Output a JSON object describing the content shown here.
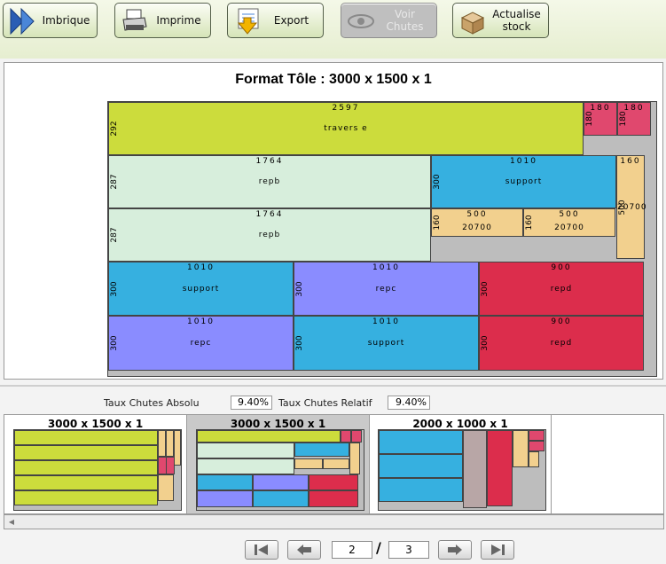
{
  "toolbar": {
    "imbrique": "Imbrique",
    "imprime": "Imprime",
    "export": "Export",
    "voir_chutes": "Voir\nChutes",
    "actualise_stock": "Actualise\nstock"
  },
  "main": {
    "title": "Format Tôle : 3000 x 1500 x 1"
  },
  "pieces": [
    {
      "w": "2597",
      "h": "292",
      "label": "travers e",
      "color": "#ccdc3c"
    },
    {
      "w": "180",
      "h": "180",
      "label": "",
      "color": "#e0486e"
    },
    {
      "w": "180",
      "h": "180",
      "label": "",
      "color": "#e0486e"
    },
    {
      "w": "1764",
      "h": "287",
      "label": "repb",
      "color": "#d7eedc"
    },
    {
      "w": "1010",
      "h": "300",
      "label": "support",
      "color": "#36b0e0"
    },
    {
      "w": "160",
      "h": "500",
      "label": "20700",
      "color": "#f2d08e"
    },
    {
      "w": "1764",
      "h": "287",
      "label": "repb",
      "color": "#d7eedc"
    },
    {
      "w": "500",
      "h": "160",
      "label": "20700",
      "color": "#f2d08e"
    },
    {
      "w": "500",
      "h": "160",
      "label": "20700",
      "color": "#f2d08e"
    },
    {
      "w": "1010",
      "h": "300",
      "label": "support",
      "color": "#36b0e0"
    },
    {
      "w": "1010",
      "h": "300",
      "label": "repc",
      "color": "#8a8cff"
    },
    {
      "w": "900",
      "h": "300",
      "label": "repd",
      "color": "#dc2d4c"
    },
    {
      "w": "1010",
      "h": "300",
      "label": "repc",
      "color": "#8a8cff"
    },
    {
      "w": "1010",
      "h": "300",
      "label": "support",
      "color": "#36b0e0"
    },
    {
      "w": "900",
      "h": "300",
      "label": "repd",
      "color": "#dc2d4c"
    }
  ],
  "rates": {
    "absolu_label": "Taux Chutes Absolu",
    "absolu_value": "9.40%",
    "relatif_label": "Taux Chutes Relatif",
    "relatif_value": "9.40%"
  },
  "thumbnails": [
    {
      "title": "3000 x 1500 x 1",
      "selected": false
    },
    {
      "title": "3000 x 1500 x 1",
      "selected": true
    },
    {
      "title": "2000 x 1000 x 1",
      "selected": false
    }
  ],
  "pagination": {
    "current": "2",
    "separator": "/",
    "total": "3"
  },
  "colors": {
    "toolbar_button": "#d6e4b8",
    "disabled_button": "#bfbfbf",
    "waste": "#bdbdbd"
  }
}
